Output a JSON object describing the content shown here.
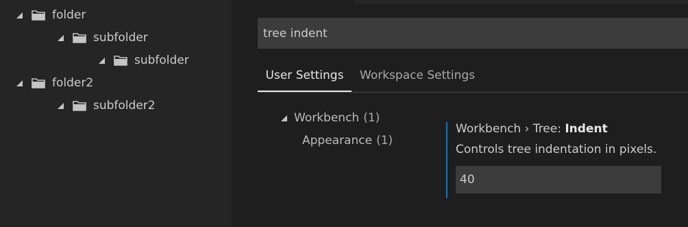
{
  "explorer": {
    "items": [
      {
        "label": "folder",
        "icon": "folder-icon"
      },
      {
        "label": "subfolder",
        "icon": "folder-icon"
      },
      {
        "label": "subfolder",
        "icon": "folder-icon"
      },
      {
        "label": "folder2",
        "icon": "folder-icon"
      },
      {
        "label": "subfolder2",
        "icon": "folder-icon"
      }
    ]
  },
  "settings": {
    "search": {
      "value": "tree indent"
    },
    "tabs": [
      {
        "label": "User Settings",
        "active": true
      },
      {
        "label": "Workspace Settings",
        "active": false
      }
    ],
    "toc": [
      {
        "label": "Workbench",
        "count": "(1)"
      },
      {
        "label": "Appearance",
        "count": "(1)"
      }
    ],
    "item": {
      "title_prefix": "Workbench › Tree: ",
      "title_name": "Indent",
      "description": "Controls tree indentation in pixels.",
      "value": "40"
    }
  },
  "colors": {
    "background": "#1e1e1e",
    "sidebar": "#252526",
    "input_background": "#3c3c3c",
    "accent": "#007acc",
    "text": "#cccccc"
  }
}
